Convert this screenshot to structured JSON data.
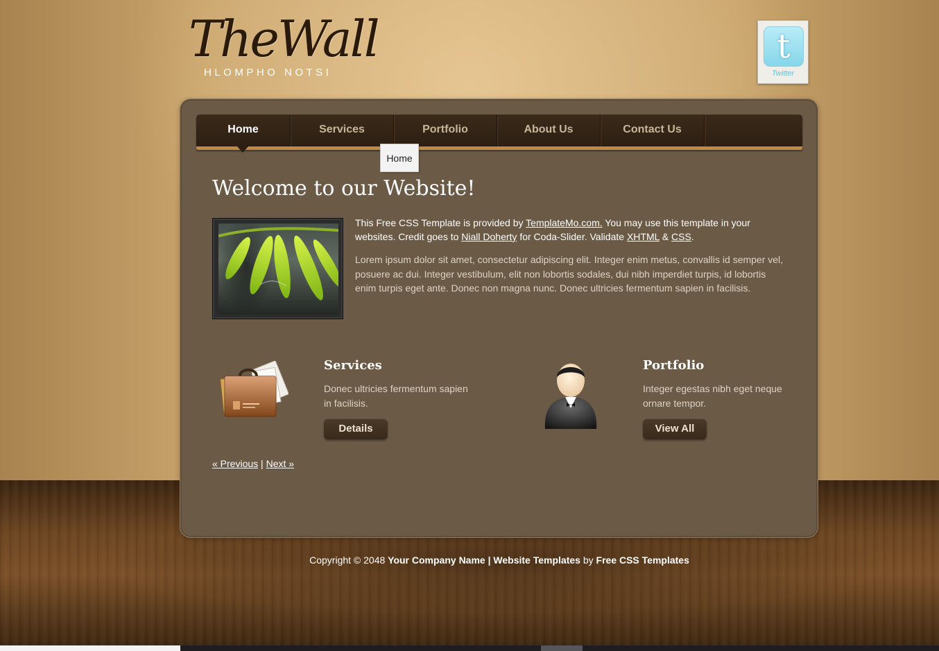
{
  "brand": {
    "title": "TheWall",
    "subtitle": "HLOMPHO NOTSI"
  },
  "social": {
    "icon": "twitter-icon",
    "label": "Twitter",
    "glyph": "t"
  },
  "nav": {
    "items": [
      {
        "label": "Home",
        "active": true
      },
      {
        "label": "Services",
        "active": false
      },
      {
        "label": "Portfolio",
        "active": false
      },
      {
        "label": "About Us",
        "active": false
      },
      {
        "label": "Contact Us",
        "active": false
      }
    ],
    "tooltip": "Home"
  },
  "main": {
    "heading": "Welcome to our Website!",
    "intro": {
      "p1": "This Free CSS Template is provided by ",
      "link1": "TemplateMo.com.",
      "p2": " You may use this template in your websites. Credit goes to ",
      "link2": "Niall Doherty",
      "p3": " for Coda-Slider. Validate ",
      "link3": "XHTML",
      "p4": " & ",
      "link4": "CSS",
      "p5": "."
    },
    "lorem": "Lorem ipsum dolor sit amet, consectetur adipiscing elit. Integer enim metus, convallis id semper vel, posuere ac dui. Integer vestibulum, elit non lobortis sodales, dui nibh imperdiet turpis, id lobortis enim turpis eget ante. Donec non magna nunc. Donec ultricies fermentum sapien in facilisis.",
    "services": {
      "icon": "briefcase-icon",
      "title": "Services",
      "text": "Donec ultricies fermentum sapien in facilisis.",
      "button": "Details"
    },
    "portfolio": {
      "icon": "user-icon",
      "title": "Portfolio",
      "text": "Integer egestas nibh eget neque ornare tempor.",
      "button": "View All"
    },
    "pager": {
      "prev": "« Previous",
      "sep": "|",
      "next": "Next »"
    }
  },
  "footer": {
    "copyright": "Copyright © 2048 ",
    "company": "Your Company Name",
    "sep": " | ",
    "templates": "Website Templates",
    "by": " by ",
    "free": "Free CSS Templates"
  }
}
